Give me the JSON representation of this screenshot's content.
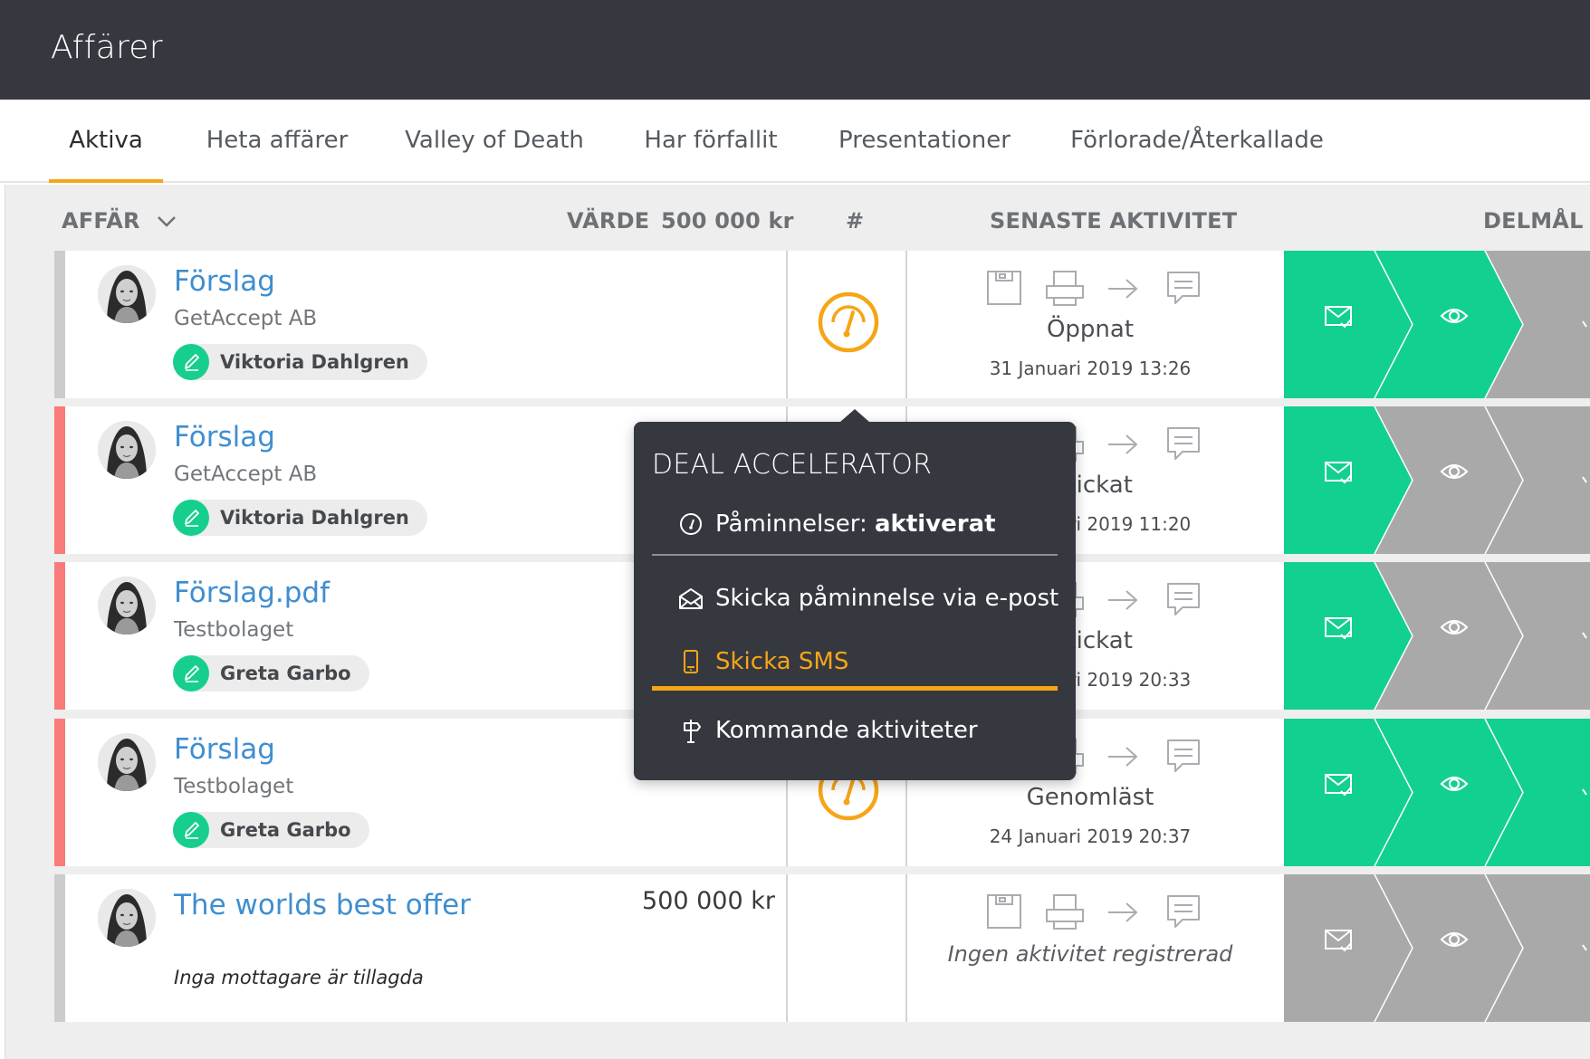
{
  "app": {
    "title": "Affärer"
  },
  "tabs": [
    {
      "label": "Aktiva",
      "active": true
    },
    {
      "label": "Heta affärer"
    },
    {
      "label": "Valley of Death"
    },
    {
      "label": "Har förfallit"
    },
    {
      "label": "Presentationer"
    },
    {
      "label": "Förlorade/Återkallade"
    }
  ],
  "columns": {
    "deal": "AFFÄR",
    "value_label": "VÄRDE",
    "value_total": "500 000 kr",
    "count": "#",
    "latest_activity": "SENASTE AKTIVITET",
    "milestones": "DELMÅL"
  },
  "rows": [
    {
      "title": "Förslag",
      "company": "GetAccept AB",
      "recipient": "Viktoria Dahlgren",
      "value": "",
      "status": "Öppnat",
      "time": "31 Januari 2019 13:26",
      "stripe": "#cccccc",
      "gauge": true,
      "steps": [
        "green",
        "green",
        "grey"
      ]
    },
    {
      "title": "Förslag",
      "company": "GetAccept AB",
      "recipient": "Viktoria Dahlgren",
      "value": "",
      "status": "Skickat",
      "time": "23 Januari 2019 11:20",
      "stripe": "#fa7a7a",
      "gauge": false,
      "steps": [
        "green",
        "grey",
        "grey"
      ]
    },
    {
      "title": "Förslag.pdf",
      "company": "Testbolaget",
      "recipient": "Greta Garbo",
      "value": "",
      "status": "Skickat",
      "time": "24 Januari 2019 20:33",
      "stripe": "#fa7a7a",
      "gauge": false,
      "steps": [
        "green",
        "grey",
        "grey"
      ]
    },
    {
      "title": "Förslag",
      "company": "Testbolaget",
      "recipient": "Greta Garbo",
      "value": "",
      "status": "Genomläst",
      "time": "24 Januari 2019 20:37",
      "stripe": "#fa7a7a",
      "gauge": true,
      "steps": [
        "green",
        "green",
        "green"
      ]
    },
    {
      "title": "The worlds best offer",
      "company": "",
      "recipient": "",
      "no_recipient": "Inga mottagare är tillagda",
      "value": "500 000 kr",
      "status": "",
      "time": "",
      "none_text": "Ingen aktivitet registrerad",
      "stripe": "#cccccc",
      "gauge": false,
      "steps": [
        "grey",
        "grey",
        "grey"
      ]
    }
  ],
  "popup": {
    "title": "DEAL ACCELERATOR",
    "reminders_label": "Påminnelser:",
    "reminders_value": "aktiverat",
    "email_label": "Skicka påminnelse via e-post",
    "sms_label": "Skicka SMS",
    "upcoming_label": "Kommande aktiviteter"
  },
  "colors": {
    "topbar": "#363840",
    "accent": "#f6a517",
    "link": "#3f8ed0",
    "step_green": "#12d090",
    "step_grey": "#a9a9a9",
    "stripe_red": "#fa7a7a"
  }
}
